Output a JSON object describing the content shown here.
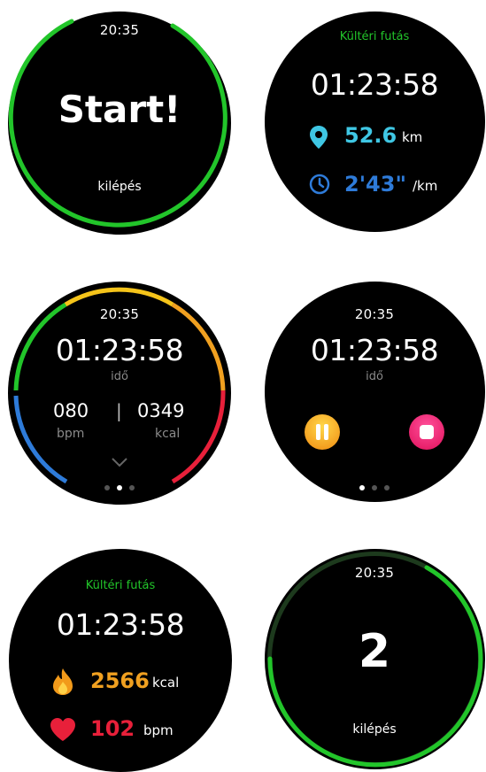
{
  "colors": {
    "green": "#22c52a",
    "cyan": "#3fc7e4",
    "blue": "#2e7bd9",
    "orange": "#f0a020",
    "red": "#e8203a",
    "yellow": "#f5c41a",
    "pink": "#ff2277"
  },
  "screen_start": {
    "time": "20:35",
    "start_label": "Start!",
    "exit_label": "kilépés"
  },
  "screen_outdoor": {
    "title": "Kültéri futás",
    "elapsed": "01:23:58",
    "distance_value": "52.6",
    "distance_unit": "km",
    "pace_value": "2'43\"",
    "pace_unit": "/km",
    "icons": [
      "location-pin-icon",
      "pace-clock-icon"
    ]
  },
  "screen_heartrate": {
    "time": "20:35",
    "elapsed": "01:23:58",
    "elapsed_label": "idő",
    "bpm_value": "080",
    "bpm_label": "bpm",
    "kcal_value": "0349",
    "kcal_label": "kcal",
    "page_indicator": {
      "count": 3,
      "active": 1
    }
  },
  "screen_controls": {
    "time": "20:35",
    "elapsed": "01:23:58",
    "elapsed_label": "idő",
    "buttons": [
      "pause-button",
      "stop-button"
    ],
    "page_indicator": {
      "count": 3,
      "active": 0
    }
  },
  "screen_calories": {
    "title": "Kültéri futás",
    "elapsed": "01:23:58",
    "kcal_value": "2566",
    "kcal_unit": "kcal",
    "bpm_value": "102",
    "bpm_unit": "bpm",
    "icons": [
      "flame-icon",
      "heart-icon"
    ]
  },
  "screen_countdown": {
    "time": "20:35",
    "countdown": "2",
    "exit_label": "kilépés",
    "progress": 0.75
  }
}
